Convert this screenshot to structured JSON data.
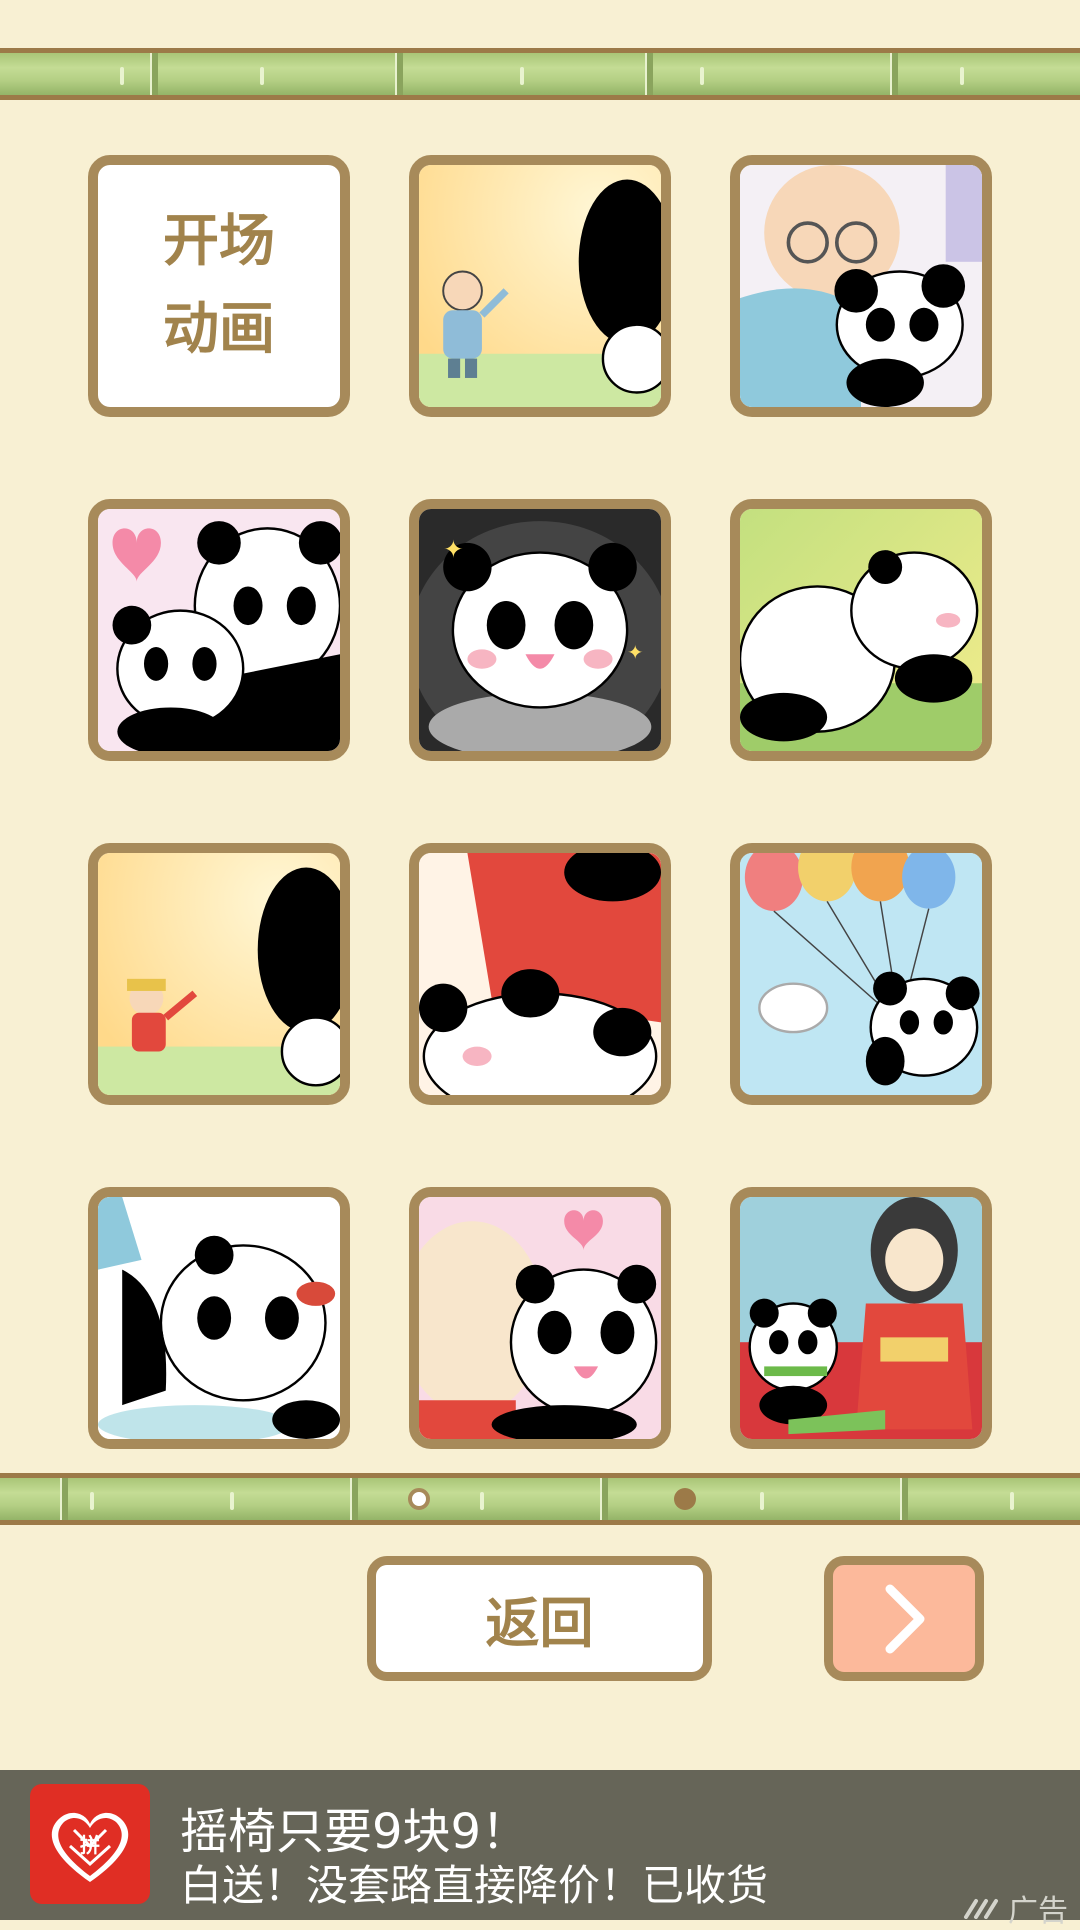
{
  "gallery": {
    "opening_tile": {
      "line1": "开场",
      "line2": "动画"
    },
    "tiles": [
      {
        "scene": "old-man-waving-panda-peek"
      },
      {
        "scene": "old-man-hugging-panda"
      },
      {
        "scene": "panda-mother-cuddle-heart"
      },
      {
        "scene": "panda-in-wok-sparkle"
      },
      {
        "scene": "panda-rolling-grass"
      },
      {
        "scene": "red-suit-man-waving-panda-peek"
      },
      {
        "scene": "red-suit-man-holding-panda"
      },
      {
        "scene": "panda-with-balloons-bird"
      },
      {
        "scene": "panda-sweating-red-bow"
      },
      {
        "scene": "man-kissing-panda-heart"
      },
      {
        "scene": "kimono-girl-panda-bamboo"
      }
    ]
  },
  "pagination": {
    "current": 1,
    "total": 2
  },
  "buttons": {
    "back_label": "返回",
    "next_icon": "chevron-right-icon"
  },
  "ad": {
    "title": "摇椅只要9块9！",
    "description": "白送！没套路直接降价！已收货",
    "badge": "广告",
    "logo_text": "拼"
  },
  "colors": {
    "background": "#f8f0d3",
    "frame": "#a78a5a",
    "label_text": "#a1834c",
    "next_button": "#fcb99b",
    "ad_bar": "#666558"
  }
}
